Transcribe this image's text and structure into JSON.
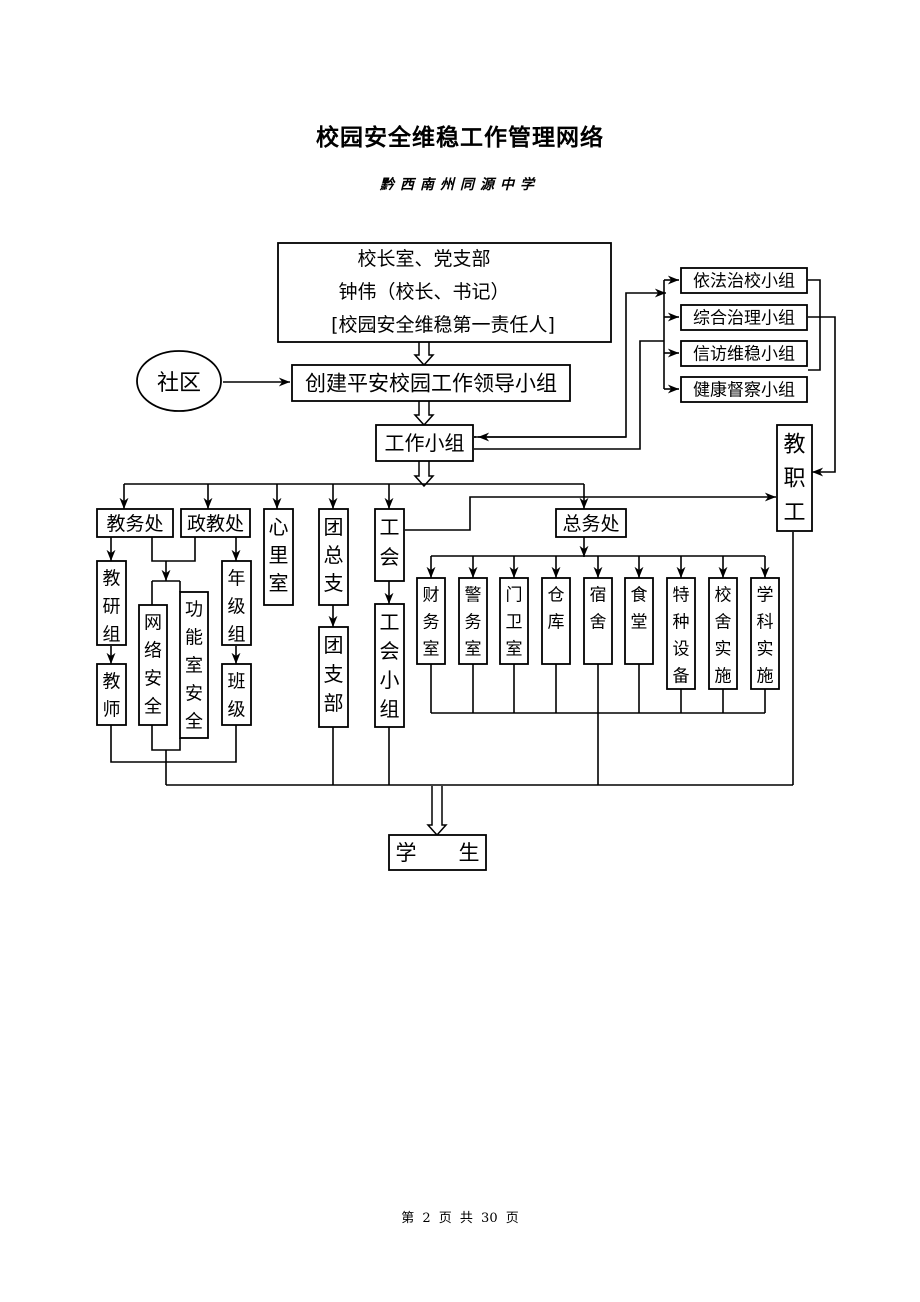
{
  "document": {
    "title": "校园安全维稳工作管理网络",
    "subtitle": "黔西南州同源中学",
    "footer": "第 2 页 共 30 页"
  },
  "diagram": {
    "top_box": {
      "line1": "校长室、党支部",
      "line2": "钟伟（校长、书记）",
      "line3": "[校园安全维稳第一责任人]"
    },
    "community": "社区",
    "leading_group": "创建平安校园工作领导小组",
    "work_group": "工作小组",
    "side_groups": [
      "依法治校小组",
      "综合治理小组",
      "信访维稳小组",
      "健康督察小组"
    ],
    "staff": "教职工",
    "departments": {
      "academic": "教务处",
      "political": "政教处",
      "psych": "心里室",
      "league": "团总支",
      "union": "工会",
      "general": "总务处"
    },
    "sub_units": {
      "teaching_research": "教研组",
      "teachers": "教师",
      "network_safety": "网络安全",
      "lab_safety": "功能室安全",
      "grade_group": "年级组",
      "classes": "班级",
      "league_branch": "团支部",
      "union_group": "工会小组"
    },
    "general_affairs_units": [
      "财务室",
      "警务室",
      "门卫室",
      "仓库",
      "宿舍",
      "食堂",
      "特种设备",
      "校舍实施",
      "学科实施"
    ],
    "students": "学　　生"
  }
}
